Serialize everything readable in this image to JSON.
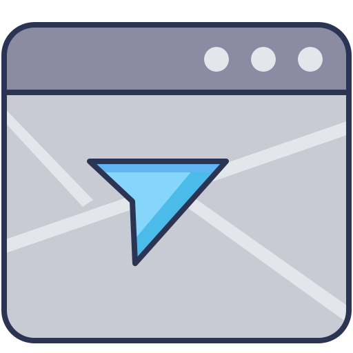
{
  "icon": {
    "name": "map-navigation-window-icon",
    "window": {
      "title_bar": {
        "controls": [
          {
            "name": "window-control-dot-1"
          },
          {
            "name": "window-control-dot-2"
          },
          {
            "name": "window-control-dot-3"
          }
        ]
      }
    },
    "colors": {
      "outline": "#2b3453",
      "title_bar": "#8b8ba3",
      "map_background": "#c8cad4",
      "map_roads": "#e3e6eb",
      "control_dots": "#e3e6eb",
      "pointer_light": "#86d6fb",
      "pointer_dark": "#4bbce9",
      "pointer_top": "#61b3f2"
    }
  }
}
